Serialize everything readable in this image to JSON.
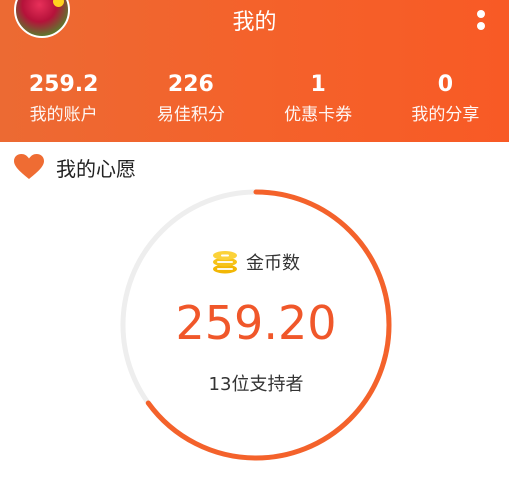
{
  "header": {
    "title": "我的"
  },
  "stats": [
    {
      "value": "259.2",
      "label": "我的账户"
    },
    {
      "value": "226",
      "label": "易佳积分"
    },
    {
      "value": "1",
      "label": "优惠卡券"
    },
    {
      "value": "0",
      "label": "我的分享"
    }
  ],
  "wish": {
    "title": "我的心愿",
    "coin_label": "金币数",
    "amount": "259.20",
    "supporters": "13位支持者",
    "progress": 0.65
  },
  "colors": {
    "accent": "#f4622b",
    "ring_track": "#eeeeee",
    "amount_text": "#f0572a"
  }
}
